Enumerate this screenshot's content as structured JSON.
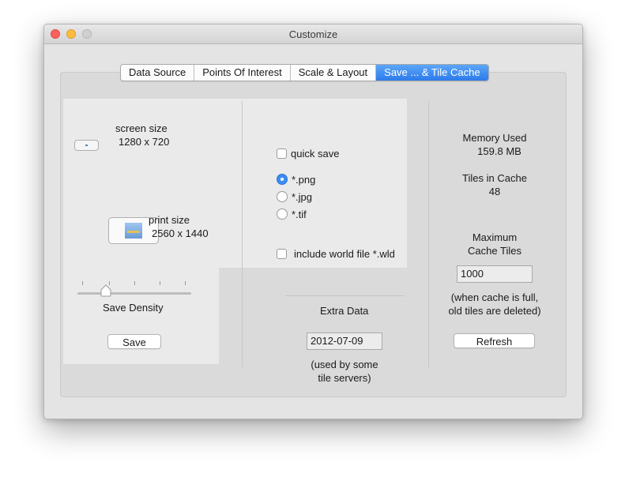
{
  "window": {
    "title": "Customize"
  },
  "tabs": [
    "Data Source",
    "Points Of Interest",
    "Scale & Layout",
    "Save ... & Tile Cache"
  ],
  "active_tab": 3,
  "save": {
    "screen_size_label": "screen size",
    "screen_size_value": "1280 x 720",
    "print_size_label": "print size",
    "print_size_value": "2560 x 1440",
    "density_label": "Save Density",
    "density_level": 0.25,
    "save_button": "Save"
  },
  "options": {
    "quick_save_label": "quick save",
    "quick_save_checked": false,
    "formats": [
      {
        "label": "*.png",
        "selected": true
      },
      {
        "label": "*.jpg",
        "selected": false
      },
      {
        "label": "*.tif",
        "selected": false
      }
    ],
    "world_file_label": "include world file *.wld",
    "world_file_checked": false
  },
  "extra": {
    "title": "Extra Data",
    "date_value": "2012-07-09",
    "note_line1": "(used by some",
    "note_line2": "tile servers)"
  },
  "cache": {
    "memory_label": "Memory Used",
    "memory_value": "159.8 MB",
    "tiles_label": "Tiles in Cache",
    "tiles_value": "48",
    "max_label_line1": "Maximum",
    "max_label_line2": "Cache Tiles",
    "max_value": "1000",
    "note_line1": "(when cache is full,",
    "note_line2": "old tiles are deleted)",
    "refresh_button": "Refresh"
  },
  "colors": {
    "accent": "#2d7bea",
    "traffic_close": "#fc605c",
    "traffic_min": "#fdbc40"
  },
  "icons": [
    "close-icon",
    "minimize-icon",
    "zoom-icon",
    "map-thumbnail-icon"
  ]
}
